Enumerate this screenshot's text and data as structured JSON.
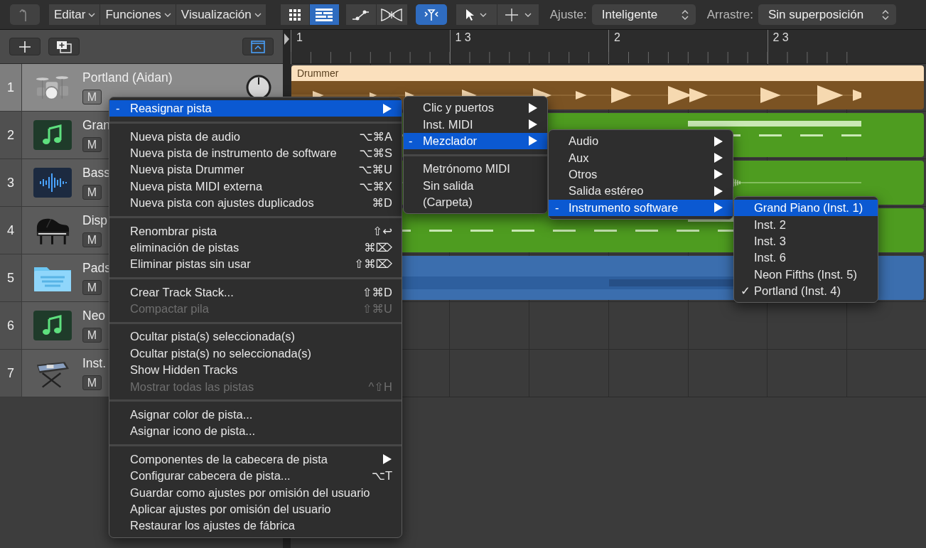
{
  "toolbar": {
    "menus": [
      {
        "label": "Editar"
      },
      {
        "label": "Funciones"
      },
      {
        "label": "Visualización"
      }
    ],
    "view_buttons": [
      {
        "selected": false
      },
      {
        "selected": true
      }
    ],
    "edit_buttons": [
      {
        "selected": false
      },
      {
        "selected": false
      },
      {
        "selected": true
      }
    ],
    "snap": {
      "label": "Ajuste:",
      "value": "Inteligente"
    },
    "drag": {
      "label": "Arrastre:",
      "value": "Sin superposición"
    }
  },
  "ruler": {
    "marks": [
      "1",
      "1 3",
      "2",
      "2 3"
    ]
  },
  "tracks": [
    {
      "number": "1",
      "name": "Portland (Aidan)",
      "selected": true,
      "mute": "M",
      "pan_knob": true,
      "region": {
        "kind": "drummer",
        "label": "Drummer",
        "color": "#fbe0bd"
      }
    },
    {
      "number": "2",
      "name": "Gran",
      "selected": false,
      "mute": "M",
      "region": {
        "kind": "midi",
        "color": "#4e9c20"
      }
    },
    {
      "number": "3",
      "name": "Bass",
      "selected": false,
      "mute": "M",
      "region": {
        "kind": "audio",
        "color": "#4e9c20"
      }
    },
    {
      "number": "4",
      "name": "Disp",
      "selected": false,
      "mute": "M",
      "region": {
        "kind": "midi",
        "color": "#4e9c20"
      }
    },
    {
      "number": "5",
      "name": "Pads",
      "selected": false,
      "mute": "M",
      "region": {
        "kind": "folder",
        "color": "#3b6eae"
      }
    },
    {
      "number": "6",
      "name": "Neo",
      "selected": false,
      "mute": "M"
    },
    {
      "number": "7",
      "name": "Inst.",
      "selected": false,
      "mute": "M"
    }
  ],
  "context_menu": {
    "sections": [
      [
        {
          "label": "Reasignar pista",
          "mark": "-",
          "submenu": true,
          "selected": true,
          "disabled": false
        }
      ],
      [
        {
          "label": "Nueva pista de audio",
          "shortcut": "⌥⌘A",
          "selected": false,
          "disabled": false
        },
        {
          "label": "Nueva pista de instrumento de software",
          "shortcut": "⌥⌘S",
          "selected": false,
          "disabled": false
        },
        {
          "label": "Nueva pista Drummer",
          "shortcut": "⌥⌘U",
          "selected": false,
          "disabled": false
        },
        {
          "label": "Nueva pista MIDI externa",
          "shortcut": "⌥⌘X",
          "selected": false,
          "disabled": false
        },
        {
          "label": "Nueva pista con ajustes duplicados",
          "shortcut": "⌘D",
          "selected": false,
          "disabled": false
        }
      ],
      [
        {
          "label": "Renombrar pista",
          "shortcut": "⇧↩",
          "selected": false,
          "disabled": false
        },
        {
          "label": "eliminación de pistas",
          "shortcut": "⌘⌦",
          "selected": false,
          "disabled": false
        },
        {
          "label": "Eliminar pistas sin usar",
          "shortcut": "⇧⌘⌦",
          "selected": false,
          "disabled": false
        }
      ],
      [
        {
          "label": "Crear Track Stack...",
          "shortcut": "⇧⌘D",
          "selected": false,
          "disabled": false
        },
        {
          "label": "Compactar pila",
          "shortcut": "⇧⌘U",
          "selected": false,
          "disabled": true
        }
      ],
      [
        {
          "label": "Ocultar pista(s) seleccionada(s)",
          "selected": false,
          "disabled": false
        },
        {
          "label": "Ocultar pista(s) no seleccionada(s)",
          "selected": false,
          "disabled": false
        },
        {
          "label": "Show Hidden Tracks",
          "selected": false,
          "disabled": false
        },
        {
          "label": "Mostrar todas las pistas",
          "shortcut": "^⇧H",
          "selected": false,
          "disabled": true
        }
      ],
      [
        {
          "label": "Asignar color de pista...",
          "selected": false,
          "disabled": false
        },
        {
          "label": "Asignar icono de pista...",
          "selected": false,
          "disabled": false
        }
      ],
      [
        {
          "label": "Componentes de la cabecera de pista",
          "submenu": true,
          "selected": false,
          "disabled": false
        },
        {
          "label": "Configurar cabecera de pista...",
          "shortcut": "⌥T",
          "selected": false,
          "disabled": false
        },
        {
          "label": "Guardar como ajustes por omisión del usuario",
          "selected": false,
          "disabled": false
        },
        {
          "label": "Aplicar ajustes por omisión del usuario",
          "selected": false,
          "disabled": false
        },
        {
          "label": "Restaurar los ajustes de fábrica",
          "selected": false,
          "disabled": false
        }
      ]
    ]
  },
  "submenus": [
    {
      "sections": [
        [
          {
            "label": "Clic y puertos",
            "submenu": true,
            "selected": false
          },
          {
            "label": "Inst. MIDI",
            "submenu": true,
            "selected": false
          },
          {
            "label": "Mezclador",
            "mark": "-",
            "submenu": true,
            "selected": true
          }
        ],
        [
          {
            "label": "Metrónomo MIDI",
            "selected": false
          },
          {
            "label": "Sin salida",
            "selected": false
          },
          {
            "label": "(Carpeta)",
            "selected": false
          }
        ]
      ]
    },
    {
      "sections": [
        [
          {
            "label": "Audio",
            "submenu": true,
            "selected": false
          },
          {
            "label": "Aux",
            "submenu": true,
            "selected": false
          },
          {
            "label": "Otros",
            "submenu": true,
            "selected": false
          },
          {
            "label": "Salida estéreo",
            "submenu": true,
            "selected": false
          },
          {
            "label": "Instrumento software",
            "mark": "-",
            "submenu": true,
            "selected": true
          }
        ]
      ]
    },
    {
      "sections": [
        [
          {
            "label": "Grand Piano (Inst. 1)",
            "selected": true
          },
          {
            "label": "Inst. 2",
            "selected": false
          },
          {
            "label": "Inst. 3",
            "selected": false
          },
          {
            "label": "Inst. 6",
            "selected": false
          },
          {
            "label": "Neon Fifths (Inst. 5)",
            "selected": false
          },
          {
            "label": "Portland (Inst. 4)",
            "mark": "✓",
            "selected": false
          }
        ]
      ]
    }
  ]
}
